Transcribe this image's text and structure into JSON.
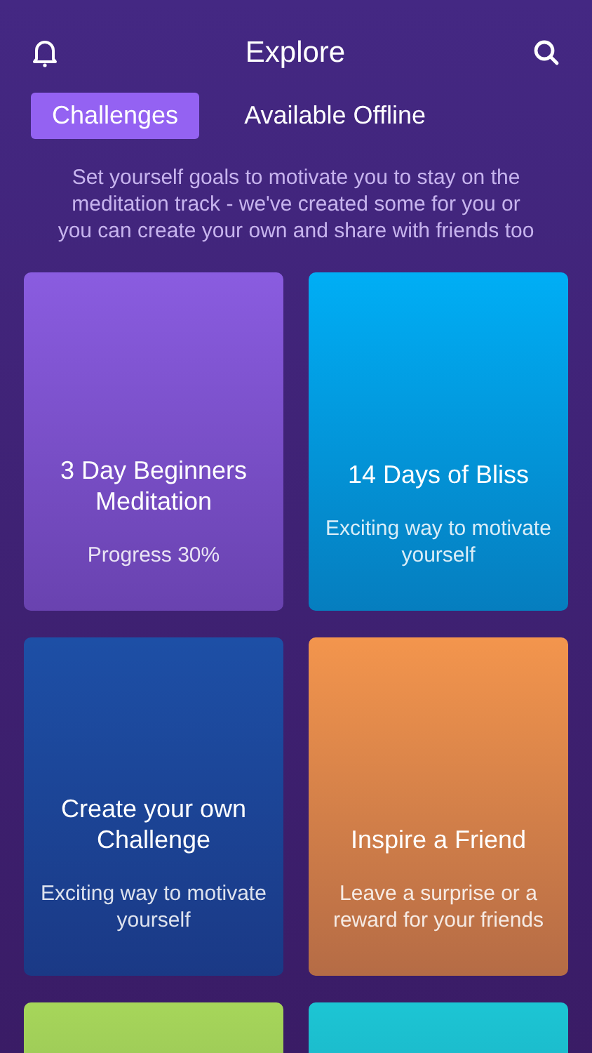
{
  "header": {
    "title": "Explore"
  },
  "tabs": [
    {
      "label": "Challenges",
      "selected": true
    },
    {
      "label": "Available Offline",
      "selected": false
    }
  ],
  "description": "Set yourself goals to motivate you to stay on the meditation track - we've created some for you or you can create your own and share with friends too",
  "cards": [
    {
      "title": "3 Day Beginners Meditation",
      "subtitle": "Progress 30%",
      "color": "#8a5ce0"
    },
    {
      "title": "14 Days of Bliss",
      "subtitle": "Exciting way to motivate yourself",
      "color": "#00aef5"
    },
    {
      "title": "Create your own Challenge",
      "subtitle": "Exciting way to motivate yourself",
      "color": "#1d4fa6"
    },
    {
      "title": "Inspire a Friend",
      "subtitle": "Leave a surprise or a reward for your friends",
      "color": "#f3954d"
    },
    {
      "color": "#a6d65a"
    },
    {
      "color": "#1cc5d4"
    }
  ]
}
